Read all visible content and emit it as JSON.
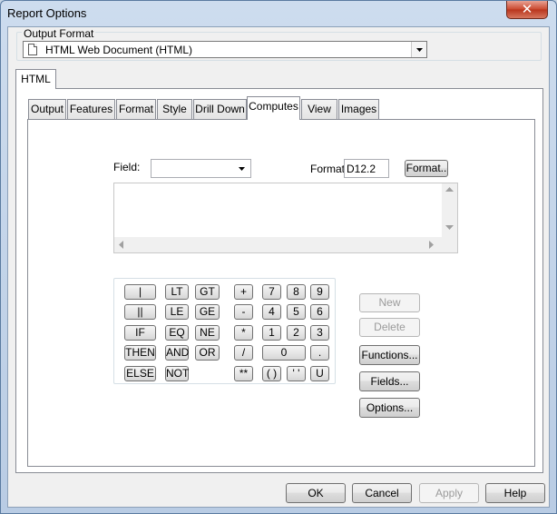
{
  "window": {
    "title": "Report Options",
    "close_glyph": "✕"
  },
  "output_format": {
    "label": "Output Format",
    "selected": "HTML Web Document (HTML)"
  },
  "outer_tab": {
    "label": "HTML"
  },
  "inner_tabs": [
    {
      "label": "Output"
    },
    {
      "label": "Features"
    },
    {
      "label": "Format"
    },
    {
      "label": "Style"
    },
    {
      "label": "Drill Down"
    },
    {
      "label": "Computes"
    },
    {
      "label": "View"
    },
    {
      "label": "Images"
    }
  ],
  "active_inner_tab": "Computes",
  "computes": {
    "field_label": "Field:",
    "field_value": "",
    "format_label": "Format:",
    "format_value": "D12.2",
    "format_button": "Format..",
    "expression_text": ""
  },
  "keypad": {
    "row1": [
      "|",
      "LT",
      "GT",
      "+",
      "7",
      "8",
      "9"
    ],
    "row2": [
      "||",
      "LE",
      "GE",
      "-",
      "4",
      "5",
      "6"
    ],
    "row3": [
      "IF",
      "EQ",
      "NE",
      "*",
      "1",
      "2",
      "3"
    ],
    "row4": [
      "THEN",
      "AND",
      "OR",
      "/",
      "0",
      "."
    ],
    "row5": [
      "ELSE",
      "NOT",
      "**",
      "( )",
      "' '",
      "U"
    ]
  },
  "side_buttons": {
    "new": "New",
    "delete": "Delete",
    "functions": "Functions...",
    "fields": "Fields...",
    "options": "Options..."
  },
  "footer": {
    "ok": "OK",
    "cancel": "Cancel",
    "apply": "Apply",
    "help": "Help"
  }
}
